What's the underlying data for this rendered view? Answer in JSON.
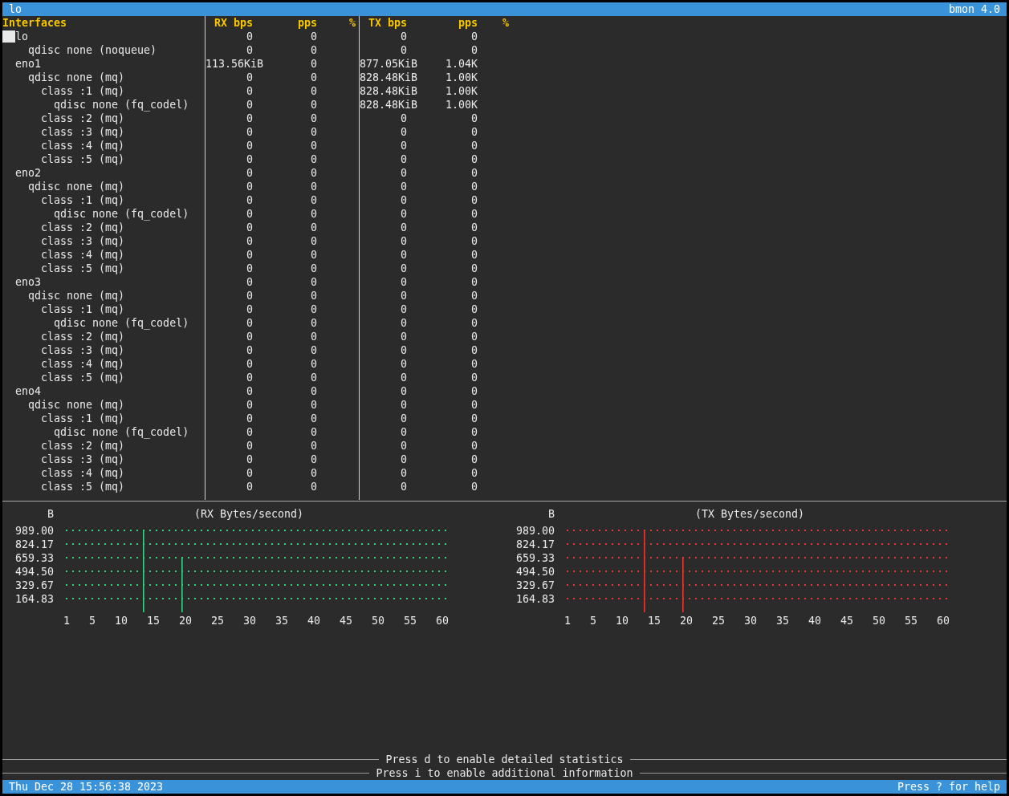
{
  "title_bar": {
    "title": "lo",
    "app": "bmon 4.0"
  },
  "table": {
    "columns": [
      "Interfaces",
      "RX bps",
      "pps",
      "%",
      "TX bps",
      "pps",
      "%"
    ],
    "interfaces": [
      {
        "name": "lo",
        "rx_bps": "0",
        "rx_pps": "0",
        "tx_bps": "0",
        "tx_pps": "0",
        "selected": true,
        "children": [
          {
            "name": "qdisc none (noqueue)",
            "rx_bps": "0",
            "rx_pps": "0",
            "tx_bps": "0",
            "tx_pps": "0",
            "selected": false
          }
        ]
      },
      {
        "name": "eno1",
        "rx_bps": "113.56KiB",
        "rx_pps": "0",
        "tx_bps": "877.05KiB",
        "tx_pps": "1.04K",
        "selected": false,
        "children": [
          {
            "name": "qdisc none (mq)",
            "rx_bps": "0",
            "rx_pps": "0",
            "tx_bps": "828.48KiB",
            "tx_pps": "1.00K",
            "selected": false,
            "children": [
              {
                "name": "class :1 (mq)",
                "rx_bps": "0",
                "rx_pps": "0",
                "tx_bps": "828.48KiB",
                "tx_pps": "1.00K",
                "selected": false,
                "children": [
                  {
                    "name": "qdisc none (fq_codel)",
                    "rx_bps": "0",
                    "rx_pps": "0",
                    "tx_bps": "828.48KiB",
                    "tx_pps": "1.00K",
                    "selected": false
                  }
                ]
              },
              {
                "name": "class :2 (mq)",
                "rx_bps": "0",
                "rx_pps": "0",
                "tx_bps": "0",
                "tx_pps": "0",
                "selected": false
              },
              {
                "name": "class :3 (mq)",
                "rx_bps": "0",
                "rx_pps": "0",
                "tx_bps": "0",
                "tx_pps": "0",
                "selected": false
              },
              {
                "name": "class :4 (mq)",
                "rx_bps": "0",
                "rx_pps": "0",
                "tx_bps": "0",
                "tx_pps": "0",
                "selected": false
              },
              {
                "name": "class :5 (mq)",
                "rx_bps": "0",
                "rx_pps": "0",
                "tx_bps": "0",
                "tx_pps": "0",
                "selected": false
              }
            ]
          }
        ]
      },
      {
        "name": "eno2",
        "rx_bps": "0",
        "rx_pps": "0",
        "tx_bps": "0",
        "tx_pps": "0",
        "selected": false,
        "children": [
          {
            "name": "qdisc none (mq)",
            "rx_bps": "0",
            "rx_pps": "0",
            "tx_bps": "0",
            "tx_pps": "0",
            "selected": false,
            "children": [
              {
                "name": "class :1 (mq)",
                "rx_bps": "0",
                "rx_pps": "0",
                "tx_bps": "0",
                "tx_pps": "0",
                "selected": false,
                "children": [
                  {
                    "name": "qdisc none (fq_codel)",
                    "rx_bps": "0",
                    "rx_pps": "0",
                    "tx_bps": "0",
                    "tx_pps": "0",
                    "selected": false
                  }
                ]
              },
              {
                "name": "class :2 (mq)",
                "rx_bps": "0",
                "rx_pps": "0",
                "tx_bps": "0",
                "tx_pps": "0",
                "selected": false
              },
              {
                "name": "class :3 (mq)",
                "rx_bps": "0",
                "rx_pps": "0",
                "tx_bps": "0",
                "tx_pps": "0",
                "selected": false
              },
              {
                "name": "class :4 (mq)",
                "rx_bps": "0",
                "rx_pps": "0",
                "tx_bps": "0",
                "tx_pps": "0",
                "selected": false
              },
              {
                "name": "class :5 (mq)",
                "rx_bps": "0",
                "rx_pps": "0",
                "tx_bps": "0",
                "tx_pps": "0",
                "selected": false
              }
            ]
          }
        ]
      },
      {
        "name": "eno3",
        "rx_bps": "0",
        "rx_pps": "0",
        "tx_bps": "0",
        "tx_pps": "0",
        "selected": false,
        "children": [
          {
            "name": "qdisc none (mq)",
            "rx_bps": "0",
            "rx_pps": "0",
            "tx_bps": "0",
            "tx_pps": "0",
            "selected": false,
            "children": [
              {
                "name": "class :1 (mq)",
                "rx_bps": "0",
                "rx_pps": "0",
                "tx_bps": "0",
                "tx_pps": "0",
                "selected": false,
                "children": [
                  {
                    "name": "qdisc none (fq_codel)",
                    "rx_bps": "0",
                    "rx_pps": "0",
                    "tx_bps": "0",
                    "tx_pps": "0",
                    "selected": false
                  }
                ]
              },
              {
                "name": "class :2 (mq)",
                "rx_bps": "0",
                "rx_pps": "0",
                "tx_bps": "0",
                "tx_pps": "0",
                "selected": false
              },
              {
                "name": "class :3 (mq)",
                "rx_bps": "0",
                "rx_pps": "0",
                "tx_bps": "0",
                "tx_pps": "0",
                "selected": false
              },
              {
                "name": "class :4 (mq)",
                "rx_bps": "0",
                "rx_pps": "0",
                "tx_bps": "0",
                "tx_pps": "0",
                "selected": false
              },
              {
                "name": "class :5 (mq)",
                "rx_bps": "0",
                "rx_pps": "0",
                "tx_bps": "0",
                "tx_pps": "0",
                "selected": false
              }
            ]
          }
        ]
      },
      {
        "name": "eno4",
        "rx_bps": "0",
        "rx_pps": "0",
        "tx_bps": "0",
        "tx_pps": "0",
        "selected": false,
        "children": [
          {
            "name": "qdisc none (mq)",
            "rx_bps": "0",
            "rx_pps": "0",
            "tx_bps": "0",
            "tx_pps": "0",
            "selected": false,
            "children": [
              {
                "name": "class :1 (mq)",
                "rx_bps": "0",
                "rx_pps": "0",
                "tx_bps": "0",
                "tx_pps": "0",
                "selected": false,
                "children": [
                  {
                    "name": "qdisc none (fq_codel)",
                    "rx_bps": "0",
                    "rx_pps": "0",
                    "tx_bps": "0",
                    "tx_pps": "0",
                    "selected": false
                  }
                ]
              },
              {
                "name": "class :2 (mq)",
                "rx_bps": "0",
                "rx_pps": "0",
                "tx_bps": "0",
                "tx_pps": "0",
                "selected": false
              },
              {
                "name": "class :3 (mq)",
                "rx_bps": "0",
                "rx_pps": "0",
                "tx_bps": "0",
                "tx_pps": "0",
                "selected": false
              },
              {
                "name": "class :4 (mq)",
                "rx_bps": "0",
                "rx_pps": "0",
                "tx_bps": "0",
                "tx_pps": "0",
                "selected": false
              },
              {
                "name": "class :5 (mq)",
                "rx_bps": "0",
                "rx_pps": "0",
                "tx_bps": "0",
                "tx_pps": "0",
                "selected": false
              }
            ]
          }
        ]
      }
    ]
  },
  "graphs": [
    {
      "color": "#36d17c",
      "chart_data": {
        "type": "bar",
        "title": "(RX Bytes/second)",
        "ylabel": "B",
        "xlim": [
          1,
          60
        ],
        "ylim": [
          0,
          989
        ],
        "grid": true,
        "x": [
          1,
          2,
          3,
          4,
          5,
          6,
          7,
          8,
          9,
          10,
          11,
          12,
          13,
          14,
          15,
          16,
          17,
          18,
          19,
          20,
          21,
          22,
          23,
          24,
          25,
          26,
          27,
          28,
          29,
          30,
          31,
          32,
          33,
          34,
          35,
          36,
          37,
          38,
          39,
          40,
          41,
          42,
          43,
          44,
          45,
          46,
          47,
          48,
          49,
          50,
          51,
          52,
          53,
          54,
          55,
          56,
          57,
          58,
          59,
          60
        ],
        "values": [
          0,
          0,
          0,
          0,
          0,
          0,
          0,
          0,
          0,
          0,
          0,
          0,
          989.0,
          0,
          0,
          0,
          0,
          0,
          659.33,
          0,
          0,
          0,
          0,
          0,
          0,
          0,
          0,
          0,
          0,
          0,
          0,
          0,
          0,
          0,
          0,
          0,
          0,
          0,
          0,
          0,
          0,
          0,
          0,
          0,
          0,
          0,
          0,
          0,
          0,
          0,
          0,
          0,
          0,
          0,
          0,
          0,
          0,
          0,
          0,
          0
        ],
        "xticks": [
          1,
          5,
          10,
          15,
          20,
          25,
          30,
          35,
          40,
          45,
          50,
          55,
          60
        ],
        "yticks": [
          {
            "value": 164.83,
            "label": "164.83"
          },
          {
            "value": 329.67,
            "label": "329.67"
          },
          {
            "value": 494.5,
            "label": "494.50"
          },
          {
            "value": 659.33,
            "label": "659.33"
          },
          {
            "value": 824.17,
            "label": "824.17"
          },
          {
            "value": 989.0,
            "label": "989.00"
          }
        ]
      }
    },
    {
      "color": "#e5372f",
      "chart_data": {
        "type": "bar",
        "title": "(TX Bytes/second)",
        "ylabel": "B",
        "xlim": [
          1,
          60
        ],
        "ylim": [
          0,
          989
        ],
        "grid": true,
        "x": [
          1,
          2,
          3,
          4,
          5,
          6,
          7,
          8,
          9,
          10,
          11,
          12,
          13,
          14,
          15,
          16,
          17,
          18,
          19,
          20,
          21,
          22,
          23,
          24,
          25,
          26,
          27,
          28,
          29,
          30,
          31,
          32,
          33,
          34,
          35,
          36,
          37,
          38,
          39,
          40,
          41,
          42,
          43,
          44,
          45,
          46,
          47,
          48,
          49,
          50,
          51,
          52,
          53,
          54,
          55,
          56,
          57,
          58,
          59,
          60
        ],
        "values": [
          0,
          0,
          0,
          0,
          0,
          0,
          0,
          0,
          0,
          0,
          0,
          0,
          989.0,
          0,
          0,
          0,
          0,
          0,
          659.33,
          0,
          0,
          0,
          0,
          0,
          0,
          0,
          0,
          0,
          0,
          0,
          0,
          0,
          0,
          0,
          0,
          0,
          0,
          0,
          0,
          0,
          0,
          0,
          0,
          0,
          0,
          0,
          0,
          0,
          0,
          0,
          0,
          0,
          0,
          0,
          0,
          0,
          0,
          0,
          0,
          0
        ],
        "xticks": [
          1,
          5,
          10,
          15,
          20,
          25,
          30,
          35,
          40,
          45,
          50,
          55,
          60
        ],
        "yticks": [
          {
            "value": 164.83,
            "label": "164.83"
          },
          {
            "value": 329.67,
            "label": "329.67"
          },
          {
            "value": 494.5,
            "label": "494.50"
          },
          {
            "value": 659.33,
            "label": "659.33"
          },
          {
            "value": 824.17,
            "label": "824.17"
          },
          {
            "value": 989.0,
            "label": "989.00"
          }
        ]
      }
    }
  ],
  "hints": [
    "Press d to enable detailed statistics",
    "Press i to enable additional information"
  ],
  "status_bar": {
    "datetime": "Thu Dec 28 15:56:38 2023",
    "help": "Press ? for help"
  }
}
